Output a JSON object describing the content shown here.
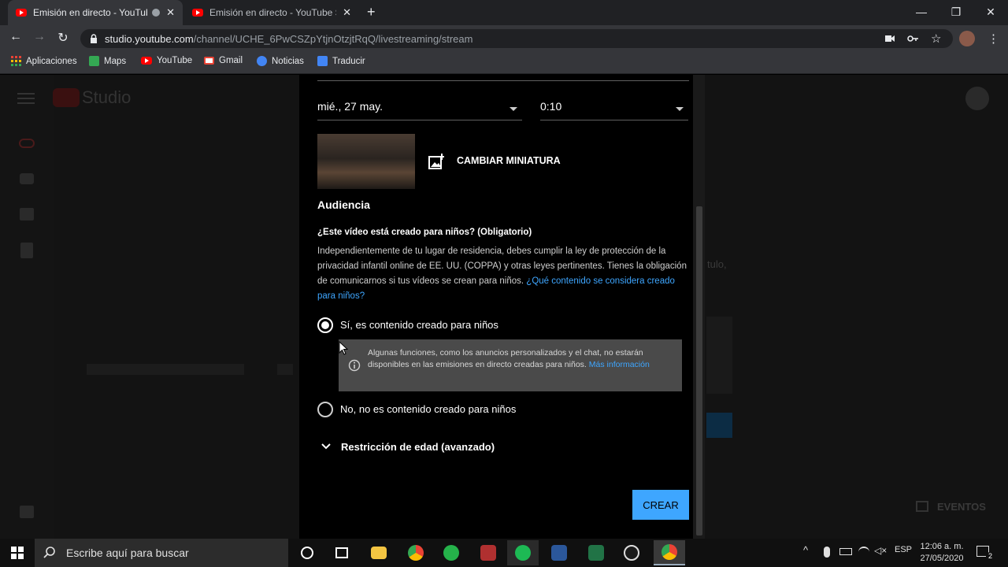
{
  "browser": {
    "tabs": [
      {
        "title": "Emisión en directo - YouTube",
        "active": true
      },
      {
        "title": "Emisión en directo - YouTube Studio",
        "active": false
      }
    ],
    "url_host": "studio.youtube.com",
    "url_path": "/channel/UCHE_6PwCSZpYtjnOtzjtRqQ/livestreaming/stream",
    "bookmarks": [
      "Aplicaciones",
      "Maps",
      "YouTube",
      "Gmail",
      "Noticias",
      "Traducir"
    ]
  },
  "studio": {
    "logo_text": "Studio",
    "bg_snippet_1": "tulo,",
    "bg_snippet_2": "EVENTOS"
  },
  "dialog": {
    "date_value": "mié., 27 may.",
    "time_value": "0:10",
    "change_thumbnail_label": "CAMBIAR MINIATURA",
    "audience_heading": "Audiencia",
    "question": "¿Este vídeo está creado para niños? (Obligatorio)",
    "paragraph": "Independientemente de tu lugar de residencia, debes cumplir la ley de protección de la privacidad infantil online de EE. UU. (COPPA) y otras leyes pertinentes. Tienes la obligación de comunicarnos si tus vídeos se crean para niños.",
    "paragraph_link": "¿Qué contenido se considera creado para niños?",
    "option_yes": "Sí, es contenido creado para niños",
    "notice_text": "Algunas funciones, como los anuncios personalizados y el chat, no estarán disponibles en las emisiones en directo creadas para niños.",
    "notice_link": "Más información",
    "option_no": "No, no es contenido creado para niños",
    "age_restriction": "Restricción de edad (avanzado)",
    "create_label": "CREAR",
    "selected_option": "yes"
  },
  "taskbar": {
    "search_placeholder": "Escribe aquí para buscar",
    "language": "ESP",
    "time": "12:06 a. m.",
    "date": "27/05/2020",
    "notification_count": "2"
  },
  "colors": {
    "accent": "#3ea6ff",
    "youtube_red": "#ff0000"
  }
}
